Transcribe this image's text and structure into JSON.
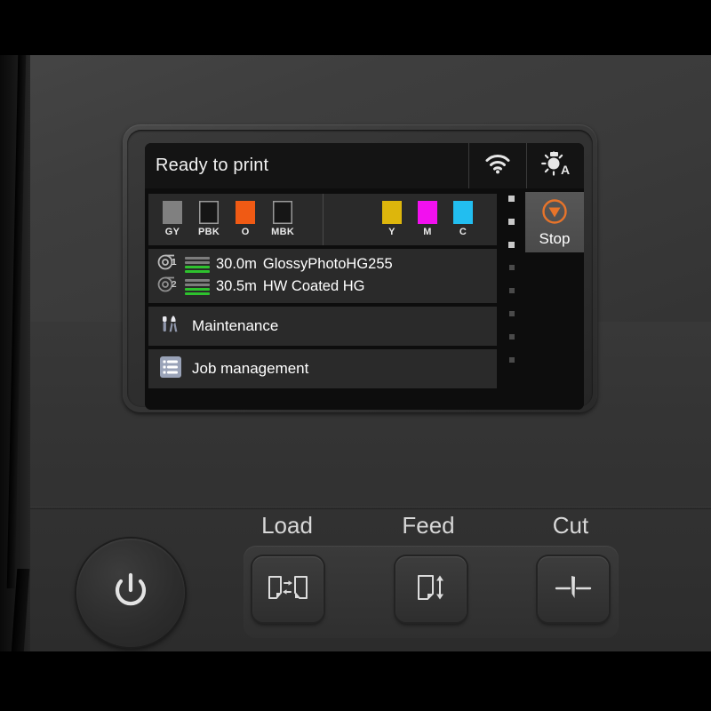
{
  "device": {
    "kind": "large-format-printer-control-panel"
  },
  "display": {
    "header": {
      "status_text": "Ready to print",
      "wifi_icon": "wifi-icon",
      "lamp_icon": "lamp-auto-icon",
      "lamp_mode": "A"
    },
    "stop_button": {
      "label": "Stop",
      "icon": "stop-icon",
      "color": "#e8742a"
    },
    "ink": {
      "group_left": [
        {
          "name": "GY",
          "color": "#808080",
          "outlined": false
        },
        {
          "name": "PBK",
          "color": "#161616",
          "outlined": true
        },
        {
          "name": "O",
          "color": "#f05a14",
          "outlined": false
        },
        {
          "name": "MBK",
          "color": "#161616",
          "outlined": true
        }
      ],
      "group_right": [
        {
          "name": "Y",
          "color": "#ddb60c",
          "outlined": false
        },
        {
          "name": "M",
          "color": "#f210ef",
          "outlined": false
        },
        {
          "name": "C",
          "color": "#22bef0",
          "outlined": false
        }
      ]
    },
    "media": [
      {
        "roll": "1",
        "length": "30.0m",
        "type": "GlossyPhotoHG255",
        "bars": [
          "gy",
          "gy",
          "gn",
          "gn"
        ]
      },
      {
        "roll": "2",
        "length": "30.5m",
        "type": "HW Coated HG",
        "bars": [
          "gy",
          "gy",
          "gn",
          "gn"
        ]
      }
    ],
    "menu": [
      {
        "label": "Maintenance",
        "icon": "tools-icon"
      },
      {
        "label": "Job management",
        "icon": "list-icon"
      }
    ],
    "rail_dots": {
      "bright": 3,
      "dim": 5
    }
  },
  "controls": {
    "power": {
      "icon": "power-icon",
      "label": ""
    },
    "buttons": [
      {
        "label": "Load",
        "icon": "load-media-icon"
      },
      {
        "label": "Feed",
        "icon": "feed-media-icon"
      },
      {
        "label": "Cut",
        "icon": "cut-media-icon"
      }
    ]
  }
}
